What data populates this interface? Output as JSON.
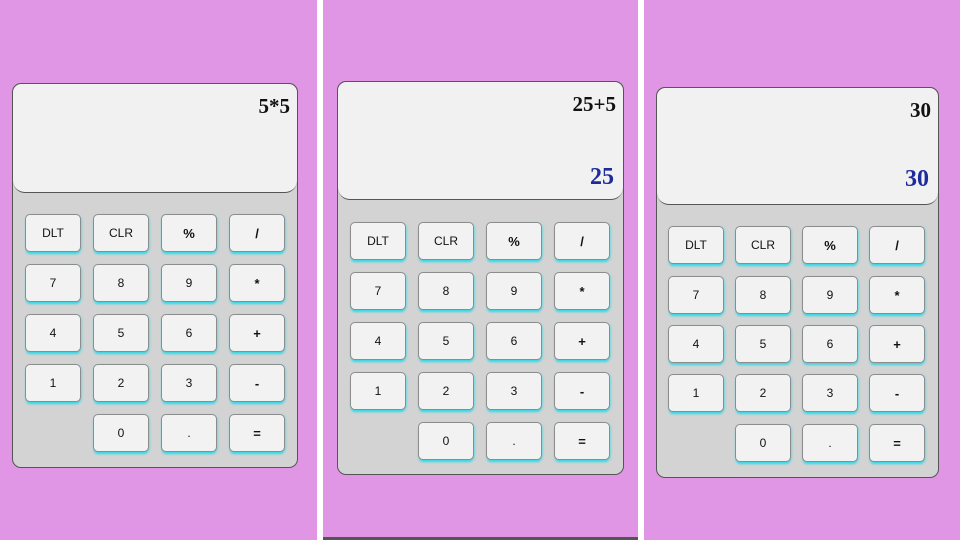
{
  "calculators": [
    {
      "expression": "5*5",
      "result": "",
      "buttons": [
        "DLT",
        "CLR",
        "%",
        "/",
        "7",
        "8",
        "9",
        "*",
        "4",
        "5",
        "6",
        "+",
        "1",
        "2",
        "3",
        "-",
        "0",
        ".",
        "="
      ]
    },
    {
      "expression": "25+5",
      "result": "25",
      "buttons": [
        "DLT",
        "CLR",
        "%",
        "/",
        "7",
        "8",
        "9",
        "*",
        "4",
        "5",
        "6",
        "+",
        "1",
        "2",
        "3",
        "-",
        "0",
        ".",
        "="
      ]
    },
    {
      "expression": "30",
      "result": "30",
      "buttons": [
        "DLT",
        "CLR",
        "%",
        "/",
        "7",
        "8",
        "9",
        "*",
        "4",
        "5",
        "6",
        "+",
        "1",
        "2",
        "3",
        "-",
        "0",
        ".",
        "="
      ]
    }
  ],
  "colors": {
    "background": "#e195e5",
    "body": "#d3d3d3",
    "display": "#f2f1f2",
    "result_text": "#1d2c9a",
    "key_glow": "#41d5e3"
  }
}
